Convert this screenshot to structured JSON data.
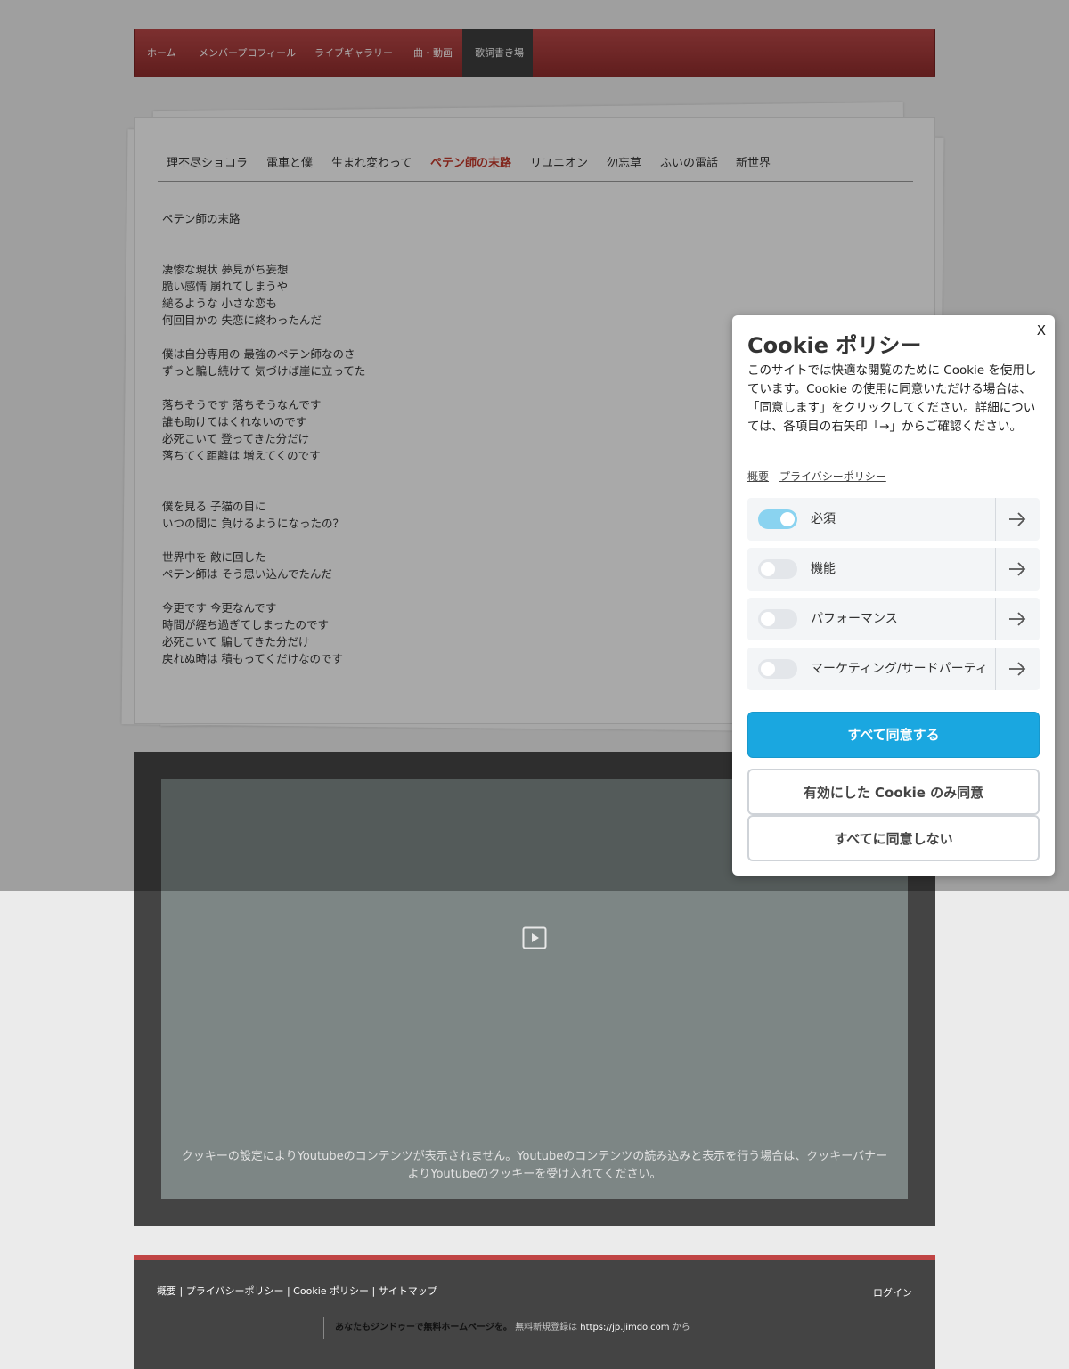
{
  "nav": {
    "items": [
      "ホーム",
      "メンバープロフィール",
      "ライブギャラリー",
      "曲・動画",
      "歌詞書き場"
    ],
    "active_index": 4
  },
  "songs": {
    "items": [
      "理不尽ショコラ",
      "電車と僕",
      "生まれ変わって",
      "ペテン師の末路",
      "リユニオン",
      "勿忘草",
      "ふいの電話",
      "新世界"
    ],
    "active_index": 3
  },
  "lyrics": {
    "title": "ペテン師の末路",
    "lines": [
      "凄惨な現状 夢見がち妄想",
      "脆い感情 崩れてしまうや",
      "縋るような 小さな恋も",
      "何回目かの 失恋に終わったんだ",
      "僕は自分専用の 最強のペテン師なのさ",
      "ずっと騙し続けて 気づけば崖に立ってた",
      "落ちそうです 落ちそうなんです",
      "誰も助けてはくれないのです",
      "必死こいて 登ってきた分だけ",
      "落ちてく距離は 増えてくのです",
      "僕を見る 子猫の目に",
      "いつの間に 負けるようになったの？",
      "世界中を 敵に回した",
      "ペテン師は そう思い込んでたんだ",
      "今更です 今更なんです",
      "時間が経ち過ぎてしまったのです",
      "必死こいて 騙してきた分だけ",
      "戻れぬ時は 積もってくだけなのです"
    ]
  },
  "video": {
    "message_part1": "クッキーの設定によりYoutubeのコンテンツが表示されません。Youtubeのコンテンツの読み込みと表示を行う場合は、",
    "message_link": "クッキーバナー",
    "message_part2": "よりYoutubeのクッキーを受け入れてください。"
  },
  "footer": {
    "links": "概要 | プライバシーポリシー | Cookie ポリシー | サイトマップ",
    "login": "ログイン",
    "jimdo_bold": "あなたもジンドゥーで無料ホームページを。",
    "jimdo_text": " 無料新規登録は ",
    "jimdo_url": "https://jp.jimdo.com",
    "jimdo_suffix": " から"
  },
  "cookie": {
    "close": "X",
    "title": "Cookie ポリシー",
    "description": "このサイトでは快適な閲覧のために Cookie を使用しています。Cookie の使用に同意いただける場合は、「同意します」をクリックしてください。詳細については、各項目の右矢印「→」からご確認ください。",
    "link_overview": "概要",
    "link_privacy": "プライバシーポリシー",
    "categories": [
      {
        "label": "必須",
        "enabled": true
      },
      {
        "label": "機能",
        "enabled": false
      },
      {
        "label": "パフォーマンス",
        "enabled": false
      },
      {
        "label": "マーケティング/サードパーティ",
        "enabled": false
      }
    ],
    "accept_all": "すべて同意する",
    "accept_selected": "有効にした Cookie のみ同意",
    "reject_all": "すべてに同意しない",
    "accent_color": "#1aa7e0"
  }
}
